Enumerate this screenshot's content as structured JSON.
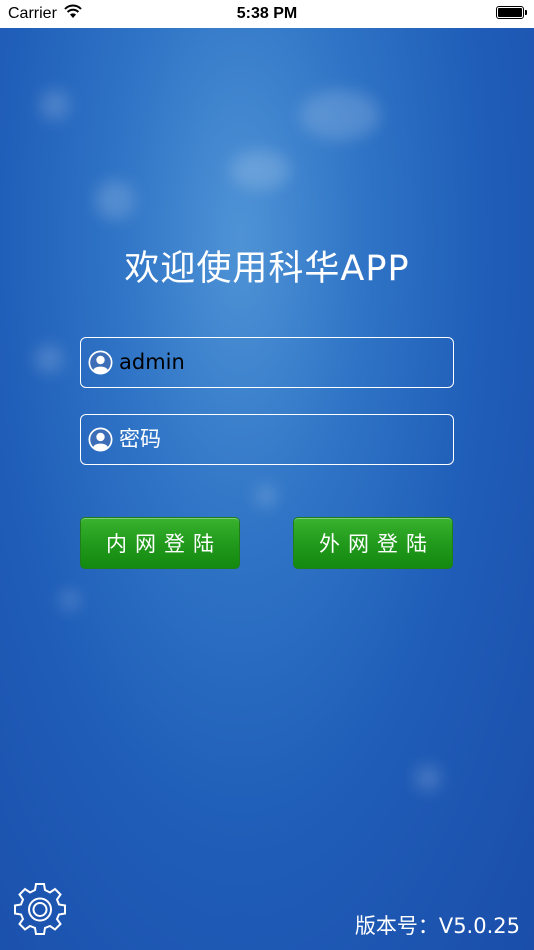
{
  "status_bar": {
    "carrier": "Carrier",
    "time": "5:38 PM",
    "battery_level": 1.0
  },
  "title": "欢迎使用科华APP",
  "username_field": {
    "value": "admin",
    "placeholder": ""
  },
  "password_field": {
    "value": "",
    "placeholder": "密码"
  },
  "buttons": {
    "intranet_login": "内网登陆",
    "extranet_login": "外网登陆"
  },
  "version": "版本号：V5.0.25",
  "colors": {
    "background": "#2f74c6",
    "button_green": "#229a1c",
    "text": "#ffffff"
  },
  "icons": {
    "user": "user-icon",
    "password": "user-icon",
    "settings": "gear-icon"
  }
}
